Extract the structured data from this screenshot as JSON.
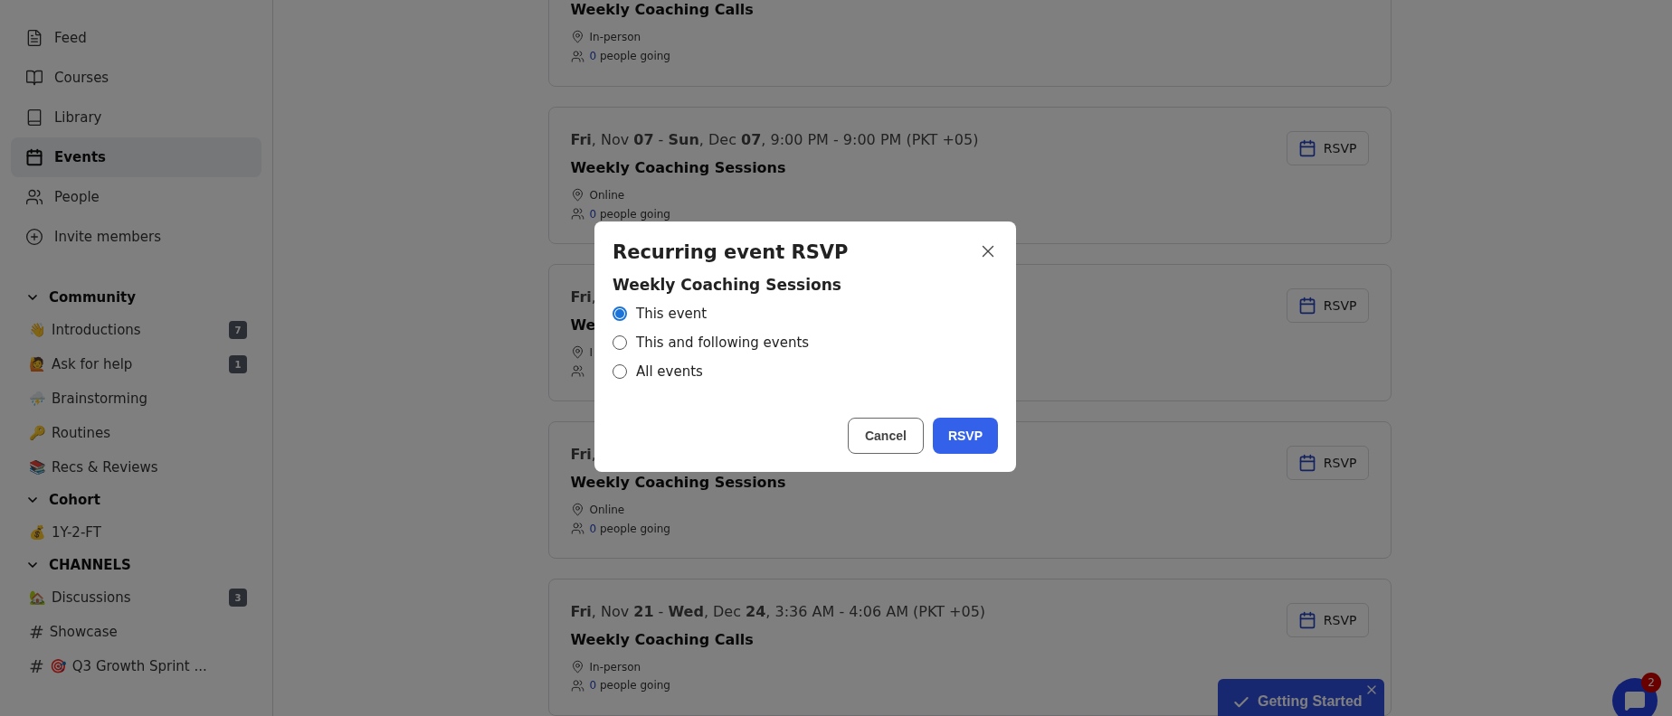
{
  "sidebar": {
    "nav": [
      {
        "label": "Feed",
        "selected": false
      },
      {
        "label": "Courses",
        "selected": false
      },
      {
        "label": "Library",
        "selected": false
      },
      {
        "label": "Events",
        "selected": true
      },
      {
        "label": "People",
        "selected": false
      },
      {
        "label": "Invite members",
        "selected": false
      }
    ],
    "groups": [
      {
        "title": "Community",
        "expanded": true,
        "items": [
          {
            "emoji": "👋",
            "label": "Introductions",
            "badge": "7"
          },
          {
            "emoji": "🙋",
            "label": "Ask for help",
            "badge": "1"
          },
          {
            "emoji": "⛈️",
            "label": "Brainstorming"
          },
          {
            "emoji": "🔑",
            "label": "Routines"
          },
          {
            "emoji": "📚",
            "label": "Recs & Reviews"
          }
        ]
      },
      {
        "title": "Cohort",
        "expanded": true,
        "items": [
          {
            "emoji": "💰",
            "label": "1Y-2-FT"
          }
        ]
      },
      {
        "title": "CHANNELS",
        "expanded": true,
        "items": [
          {
            "emoji": "🏡",
            "label": "Discussions",
            "badge": "3"
          },
          {
            "hash": "#",
            "label": "Showcase"
          },
          {
            "hash": "#",
            "emoji": "🎯",
            "label": "Q3 Growth Sprint ..."
          }
        ]
      }
    ]
  },
  "events": [
    {
      "title": "Weekly Coaching Calls",
      "location": "In-person",
      "going_count": "0",
      "going_label": "people going"
    },
    {
      "date": "**Fri**, Nov **07** - **Sun**, Dec **07**, 9:00 PM - 9:00 PM (PKT +05)",
      "title": "Weekly Coaching Sessions",
      "location": "Online",
      "going_count": "0",
      "going_label": "people going",
      "rsvp": "RSVP"
    },
    {
      "date": "**Fri**,",
      "title": "We",
      "location": "I",
      "rsvp": "RSVP"
    },
    {
      "date": "**Fri**,",
      "title": "Weekly Coaching Sessions",
      "location": "Online",
      "going_count": "0",
      "going_label": "people going",
      "rsvp": "RSVP"
    },
    {
      "date": "**Fri**, Nov **21** - **Wed**, Dec **24**, 3:36 AM - 4:06 AM (PKT +05)",
      "title": "Weekly Coaching Calls",
      "location": "In-person",
      "going_count": "0",
      "going_label": "people going",
      "rsvp": "RSVP"
    }
  ],
  "modal": {
    "title": "Recurring event RSVP",
    "subtitle": "Weekly Coaching Sessions",
    "options": [
      {
        "label": "This event",
        "selected": true
      },
      {
        "label": "This and following events",
        "selected": false
      },
      {
        "label": "All events",
        "selected": false
      }
    ],
    "cancel": "Cancel",
    "confirm": "RSVP"
  },
  "getting_started": {
    "label": "Getting Started"
  },
  "chat": {
    "badge": "2"
  }
}
